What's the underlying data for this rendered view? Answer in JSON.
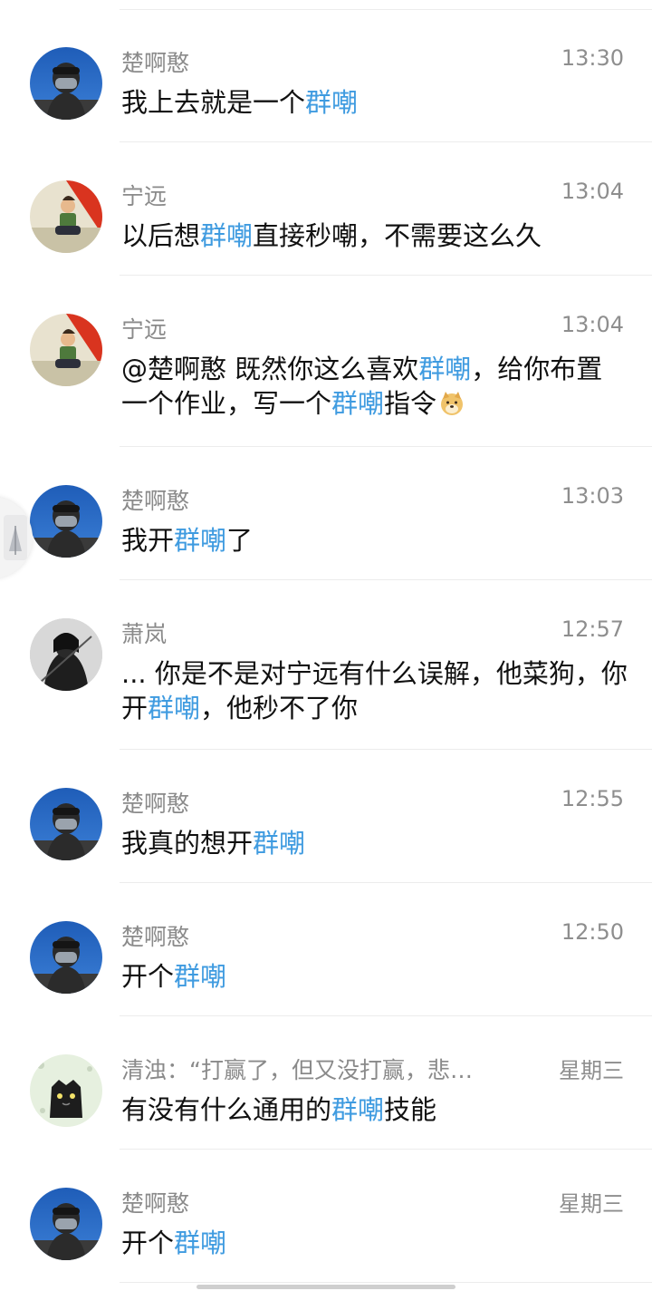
{
  "items": [
    {
      "name": "楚啊憨",
      "time": "13:30",
      "avatar": "blue-sky-avatar",
      "segments": [
        {
          "t": "我上去就是一个"
        },
        {
          "t": "群嘲",
          "hl": true
        }
      ]
    },
    {
      "name": "宁远",
      "time": "13:04",
      "avatar": "red-cartoon-avatar",
      "segments": [
        {
          "t": "以后想"
        },
        {
          "t": "群嘲",
          "hl": true
        },
        {
          "t": "直接秒嘲，不需要这么久"
        }
      ]
    },
    {
      "name": "宁远",
      "time": "13:04",
      "avatar": "red-cartoon-avatar",
      "segments": [
        {
          "t": "@楚啊憨 既然你这么喜欢"
        },
        {
          "t": "群嘲",
          "hl": true
        },
        {
          "t": "，给你布置一个作业，写一个"
        },
        {
          "t": "群嘲",
          "hl": true
        },
        {
          "t": "指令"
        }
      ],
      "emoji": "doge-emoji"
    },
    {
      "name": "楚啊憨",
      "time": "13:03",
      "avatar": "blue-sky-avatar",
      "segments": [
        {
          "t": "我开"
        },
        {
          "t": "群嘲",
          "hl": true
        },
        {
          "t": "了"
        }
      ]
    },
    {
      "name": "萧岚",
      "time": "12:57",
      "avatar": "dark-character-avatar",
      "segments": [
        {
          "t": "... 你是不是对宁远有什么误解，他菜狗，你开"
        },
        {
          "t": "群嘲",
          "hl": true
        },
        {
          "t": "，他秒不了你"
        }
      ]
    },
    {
      "name": "楚啊憨",
      "time": "12:55",
      "avatar": "blue-sky-avatar",
      "segments": [
        {
          "t": "我真的想开"
        },
        {
          "t": "群嘲",
          "hl": true
        }
      ]
    },
    {
      "name": "楚啊憨",
      "time": "12:50",
      "avatar": "blue-sky-avatar",
      "segments": [
        {
          "t": "开个"
        },
        {
          "t": "群嘲",
          "hl": true
        }
      ]
    },
    {
      "name": "清浊：“打赢了，但又没打赢，悲…",
      "time": "星期三",
      "avatar": "cat-sketch-avatar",
      "segments": [
        {
          "t": "有没有什么通用的"
        },
        {
          "t": "群嘲",
          "hl": true
        },
        {
          "t": "技能"
        }
      ]
    },
    {
      "name": "楚啊憨",
      "time": "星期三",
      "avatar": "blue-sky-avatar",
      "segments": [
        {
          "t": "开个"
        },
        {
          "t": "群嘲",
          "hl": true
        }
      ]
    }
  ],
  "colors": {
    "highlight": "#3f9be0",
    "name": "#8a8a8a",
    "text": "#111111"
  }
}
